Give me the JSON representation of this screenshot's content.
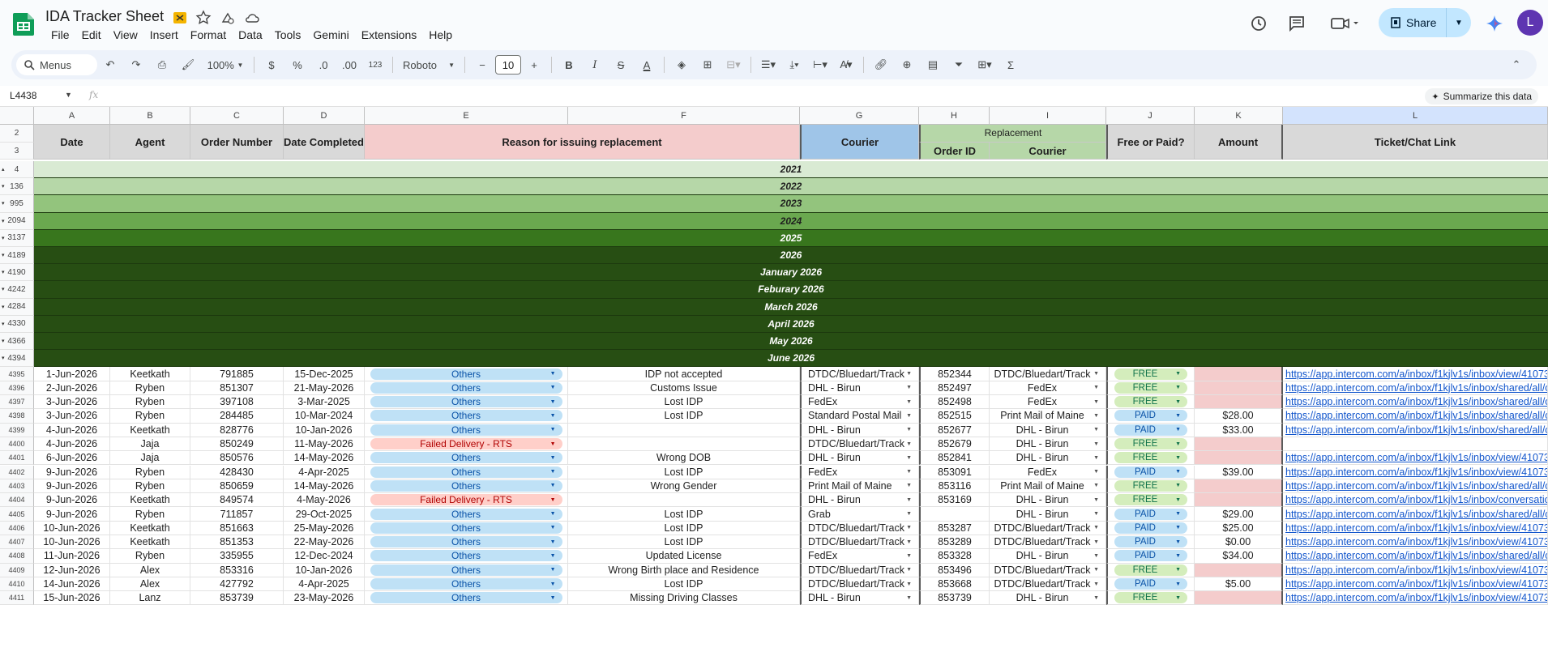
{
  "app": {
    "title": "IDA Tracker Sheet",
    "menu": [
      "File",
      "Edit",
      "View",
      "Insert",
      "Format",
      "Data",
      "Tools",
      "Gemini",
      "Extensions",
      "Help"
    ],
    "share_label": "Share",
    "avatar_letter": "L"
  },
  "toolbar": {
    "search_label": "Menus",
    "zoom": "100%",
    "currency": "$",
    "percent": "%",
    "dec_decrease": ".0",
    "dec_increase": ".00",
    "number_format": "123",
    "font": "Roboto",
    "font_size": "10"
  },
  "formula_bar": {
    "name_box": "L4438",
    "fx": "fx",
    "summarize_label": "Summarize this data"
  },
  "columns": [
    "A",
    "B",
    "C",
    "D",
    "E",
    "F",
    "G",
    "H",
    "I",
    "J",
    "K",
    "L"
  ],
  "header": {
    "row_numbers": [
      "2",
      "3"
    ],
    "date": "Date",
    "agent": "Agent",
    "order_number": "Order Number",
    "date_completed": "Date Completed",
    "reason": "Reason for issuing replacement",
    "courier": "Courier",
    "replacement": "Replacement",
    "order_id": "Order ID",
    "replacement_courier": "Courier",
    "free_or_paid": "Free or Paid?",
    "amount": "Amount",
    "ticket_link": "Ticket/Chat Link"
  },
  "groups": [
    {
      "row": "4",
      "label": "2021",
      "color": "#d9ead3",
      "text_color": "#1f1f1f"
    },
    {
      "row": "136",
      "label": "2022",
      "color": "#b6d7a8",
      "text_color": "#1f1f1f"
    },
    {
      "row": "995",
      "label": "2023",
      "color": "#93c47d",
      "text_color": "#1f1f1f"
    },
    {
      "row": "2094",
      "label": "2024",
      "color": "#6aa84f",
      "text_color": "#1f1f1f"
    },
    {
      "row": "3137",
      "label": "2025",
      "color": "#38761d",
      "text_color": "#ffffff"
    },
    {
      "row": "4189",
      "label": "2026",
      "color": "#274e13",
      "text_color": "#ffffff"
    },
    {
      "row": "4190",
      "label": "January 2026",
      "color": "#274e13",
      "text_color": "#ffffff"
    },
    {
      "row": "4242",
      "label": "Feburary 2026",
      "color": "#274e13",
      "text_color": "#ffffff"
    },
    {
      "row": "4284",
      "label": "March 2026",
      "color": "#274e13",
      "text_color": "#ffffff"
    },
    {
      "row": "4330",
      "label": "April 2026",
      "color": "#274e13",
      "text_color": "#ffffff"
    },
    {
      "row": "4366",
      "label": "May 2026",
      "color": "#274e13",
      "text_color": "#ffffff"
    },
    {
      "row": "4394",
      "label": "June 2026",
      "color": "#274e13",
      "text_color": "#ffffff"
    }
  ],
  "rows": [
    {
      "n": "4395",
      "date": "1-Jun-2026",
      "agent": "Keetkath",
      "order": "791885",
      "completed": "15-Dec-2025",
      "reason": "Others",
      "note": "IDP not accepted",
      "courier": "DTDC/Bluedart/Track",
      "order_id": "852344",
      "rcourier": "DTDC/Bluedart/Track",
      "paid": "FREE",
      "amount": "",
      "link": "https://app.intercom.com/a/inbox/f1kjlv1s/inbox/view/41073"
    },
    {
      "n": "4396",
      "date": "2-Jun-2026",
      "agent": "Ryben",
      "order": "851307",
      "completed": "21-May-2026",
      "reason": "Others",
      "note": "Customs Issue",
      "courier": "DHL - Birun",
      "order_id": "852497",
      "rcourier": "FedEx",
      "paid": "FREE",
      "amount": "",
      "link": "https://app.intercom.com/a/inbox/f1kjlv1s/inbox/shared/all/c"
    },
    {
      "n": "4397",
      "date": "3-Jun-2026",
      "agent": "Ryben",
      "order": "397108",
      "completed": "3-Mar-2025",
      "reason": "Others",
      "note": "Lost IDP",
      "courier": "FedEx",
      "order_id": "852498",
      "rcourier": "FedEx",
      "paid": "FREE",
      "amount": "",
      "link": "https://app.intercom.com/a/inbox/f1kjlv1s/inbox/shared/all/c"
    },
    {
      "n": "4398",
      "date": "3-Jun-2026",
      "agent": "Ryben",
      "order": "284485",
      "completed": "10-Mar-2024",
      "reason": "Others",
      "note": "Lost IDP",
      "courier": "Standard Postal Mail",
      "order_id": "852515",
      "rcourier": "Print Mail of Maine",
      "paid": "PAID",
      "amount": "$28.00",
      "link": "https://app.intercom.com/a/inbox/f1kjlv1s/inbox/shared/all/c"
    },
    {
      "n": "4399",
      "date": "4-Jun-2026",
      "agent": "Keetkath",
      "order": "828776",
      "completed": "10-Jan-2026",
      "reason": "Others",
      "note": "",
      "courier": "DHL - Birun",
      "order_id": "852677",
      "rcourier": "DHL - Birun",
      "paid": "PAID",
      "amount": "$33.00",
      "link": "https://app.intercom.com/a/inbox/f1kjlv1s/inbox/shared/all/c"
    },
    {
      "n": "4400",
      "date": "4-Jun-2026",
      "agent": "Jaja",
      "order": "850249",
      "completed": "11-May-2026",
      "reason": "Failed Delivery - RTS",
      "note": "",
      "courier": "DTDC/Bluedart/Track",
      "order_id": "852679",
      "rcourier": "DHL - Birun",
      "paid": "FREE",
      "amount": "",
      "link": ""
    },
    {
      "n": "4401",
      "date": "6-Jun-2026",
      "agent": "Jaja",
      "order": "850576",
      "completed": "14-May-2026",
      "reason": "Others",
      "note": "Wrong DOB",
      "courier": "DHL - Birun",
      "order_id": "852841",
      "rcourier": "DHL - Birun",
      "paid": "FREE",
      "amount": "",
      "link": "https://app.intercom.com/a/inbox/f1kjlv1s/inbox/view/41073"
    },
    {
      "n": "4402",
      "date": "9-Jun-2026",
      "agent": "Ryben",
      "order": "428430",
      "completed": "4-Apr-2025",
      "reason": "Others",
      "note": "Lost IDP",
      "courier": "FedEx",
      "order_id": "853091",
      "rcourier": "FedEx",
      "paid": "PAID",
      "amount": "$39.00",
      "link": "https://app.intercom.com/a/inbox/f1kjlv1s/inbox/view/41073"
    },
    {
      "n": "4403",
      "date": "9-Jun-2026",
      "agent": "Ryben",
      "order": "850659",
      "completed": "14-May-2026",
      "reason": "Others",
      "note": "Wrong Gender",
      "courier": "Print Mail of Maine",
      "order_id": "853116",
      "rcourier": "Print Mail of Maine",
      "paid": "FREE",
      "amount": "",
      "link": "https://app.intercom.com/a/inbox/f1kjlv1s/inbox/shared/all/c"
    },
    {
      "n": "4404",
      "date": "9-Jun-2026",
      "agent": "Keetkath",
      "order": "849574",
      "completed": "4-May-2026",
      "reason": "Failed Delivery - RTS",
      "note": "",
      "courier": "DHL - Birun",
      "order_id": "853169",
      "rcourier": "DHL - Birun",
      "paid": "FREE",
      "amount": "",
      "link": "https://app.intercom.com/a/inbox/f1kjlv1s/inbox/conversatio"
    },
    {
      "n": "4405",
      "date": "9-Jun-2026",
      "agent": "Ryben",
      "order": "711857",
      "completed": "29-Oct-2025",
      "reason": "Others",
      "note": "Lost IDP",
      "courier": "Grab",
      "order_id": "",
      "rcourier": "DHL - Birun",
      "paid": "PAID",
      "amount": "$29.00",
      "link": "https://app.intercom.com/a/inbox/f1kjlv1s/inbox/shared/all/c"
    },
    {
      "n": "4406",
      "date": "10-Jun-2026",
      "agent": "Keetkath",
      "order": "851663",
      "completed": "25-May-2026",
      "reason": "Others",
      "note": "Lost IDP",
      "courier": "DTDC/Bluedart/Track",
      "order_id": "853287",
      "rcourier": "DTDC/Bluedart/Track",
      "paid": "PAID",
      "amount": "$25.00",
      "link": "https://app.intercom.com/a/inbox/f1kjlv1s/inbox/view/41073"
    },
    {
      "n": "4407",
      "date": "10-Jun-2026",
      "agent": "Keetkath",
      "order": "851353",
      "completed": "22-May-2026",
      "reason": "Others",
      "note": "Lost IDP",
      "courier": "DTDC/Bluedart/Track",
      "order_id": "853289",
      "rcourier": "DTDC/Bluedart/Track",
      "paid": "PAID",
      "amount": "$0.00",
      "link": "https://app.intercom.com/a/inbox/f1kjlv1s/inbox/view/41073"
    },
    {
      "n": "4408",
      "date": "11-Jun-2026",
      "agent": "Ryben",
      "order": "335955",
      "completed": "12-Dec-2024",
      "reason": "Others",
      "note": "Updated License",
      "courier": "FedEx",
      "order_id": "853328",
      "rcourier": "DHL - Birun",
      "paid": "PAID",
      "amount": "$34.00",
      "link": "https://app.intercom.com/a/inbox/f1kjlv1s/inbox/shared/all/c"
    },
    {
      "n": "4409",
      "date": "12-Jun-2026",
      "agent": "Alex",
      "order": "853316",
      "completed": "10-Jan-2026",
      "reason": "Others",
      "note": "Wrong Birth place and Residence",
      "courier": "DTDC/Bluedart/Track",
      "order_id": "853496",
      "rcourier": "DTDC/Bluedart/Track",
      "paid": "FREE",
      "amount": "",
      "link": "https://app.intercom.com/a/inbox/f1kjlv1s/inbox/view/41073"
    },
    {
      "n": "4410",
      "date": "14-Jun-2026",
      "agent": "Alex",
      "order": "427792",
      "completed": "4-Apr-2025",
      "reason": "Others",
      "note": "Lost IDP",
      "courier": "DTDC/Bluedart/Track",
      "order_id": "853668",
      "rcourier": "DTDC/Bluedart/Track",
      "paid": "PAID",
      "amount": "$5.00",
      "link": "https://app.intercom.com/a/inbox/f1kjlv1s/inbox/view/41073"
    },
    {
      "n": "4411",
      "date": "15-Jun-2026",
      "agent": "Lanz",
      "order": "853739",
      "completed": "23-May-2026",
      "reason": "Others",
      "note": "Missing Driving Classes",
      "courier": "DHL - Birun",
      "order_id": "853739",
      "rcourier": "DHL - Birun",
      "paid": "FREE",
      "amount": "",
      "link": "https://app.intercom.com/a/inbox/f1kjlv1s/inbox/view/41073"
    }
  ],
  "colors": {
    "header_grey": "#d9d9d9",
    "reason_header": "#f4cccc",
    "courier_header": "#9fc5e8",
    "replacement_header": "#b6d7a8",
    "chip_others": "#bfe1f6",
    "chip_rts": "#ffcfc9",
    "chip_free": "#d4edbc",
    "chip_paid": "#bfe1f6",
    "empty_amount": "#f4cccc",
    "link": "#1155cc"
  },
  "icons": [
    "sheets-logo",
    "move-icon",
    "star-icon",
    "drive-status-icon",
    "cloud-icon",
    "history-icon",
    "comment-icon",
    "meet-icon",
    "gemini-icon"
  ]
}
